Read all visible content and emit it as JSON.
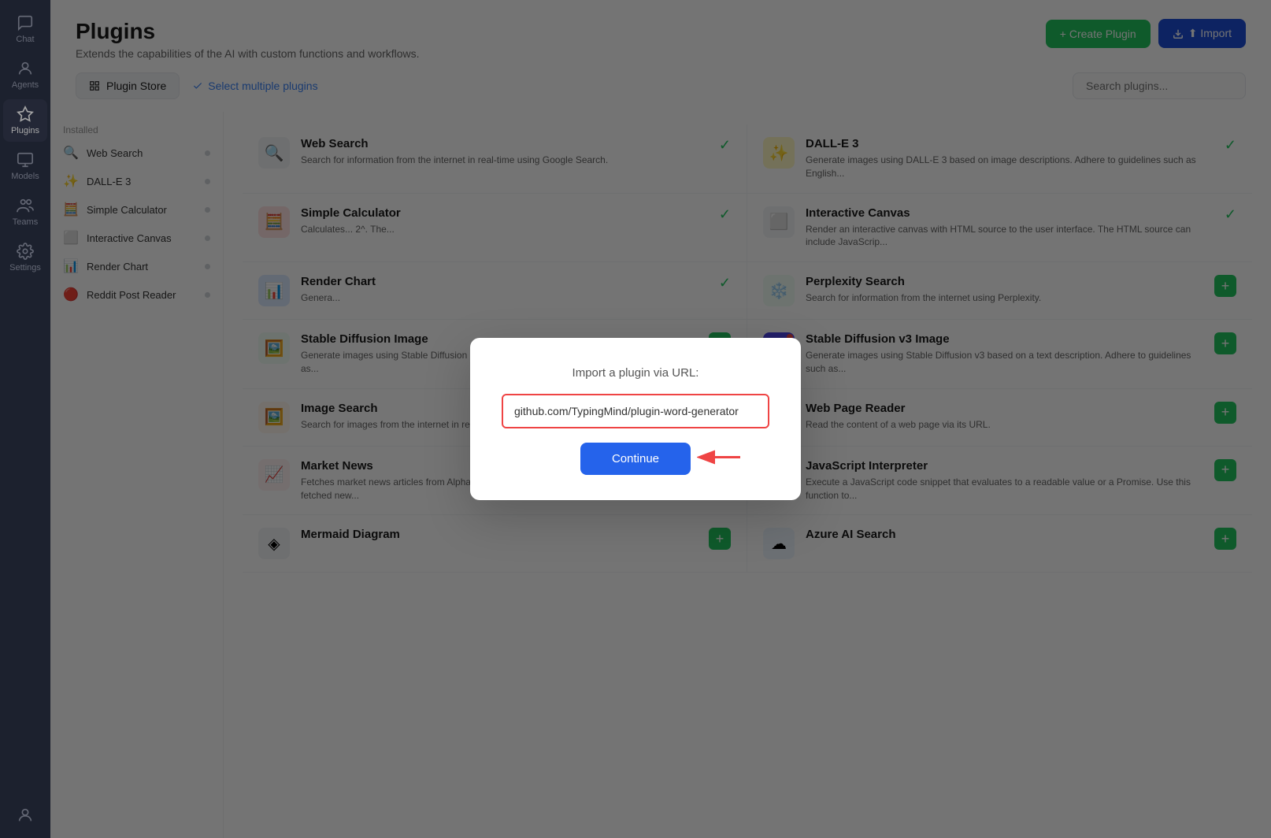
{
  "sidebar": {
    "items": [
      {
        "label": "Chat",
        "icon": "chat"
      },
      {
        "label": "Agents",
        "icon": "agents"
      },
      {
        "label": "Plugins",
        "icon": "plugins",
        "active": true
      },
      {
        "label": "Models",
        "icon": "models"
      },
      {
        "label": "Teams",
        "icon": "teams"
      },
      {
        "label": "Settings",
        "icon": "settings"
      }
    ],
    "bottom_user": "user-avatar"
  },
  "header": {
    "title": "Plugins",
    "subtitle": "Extends the capabilities of the AI with custom functions and workflows.",
    "create_label": "+ Create Plugin",
    "import_label": "⬆ Import"
  },
  "toolbar": {
    "plugin_store_label": "Plugin Store",
    "select_multiple_label": "Select multiple plugins",
    "search_placeholder": "Search plugins..."
  },
  "installed_label": "Installed",
  "sidebar_list": [
    {
      "name": "Web Search",
      "icon": "🔍"
    },
    {
      "name": "DALL-E 3",
      "icon": "✨"
    },
    {
      "name": "Simple Calculator",
      "icon": "🧮"
    },
    {
      "name": "Interactive Canvas",
      "icon": "⬜"
    },
    {
      "name": "Render Chart",
      "icon": "📊"
    },
    {
      "name": "Reddit Post Reader",
      "icon": "🔴"
    }
  ],
  "plugins": [
    {
      "name": "Web Search",
      "desc": "Search for information from the internet in real-time using Google Search.",
      "icon": "🔍",
      "icon_bg": "#f3f4f6",
      "status": "installed"
    },
    {
      "name": "DALL-E 3",
      "desc": "Generate images using DALL-E 3 based on image descriptions. Adhere to guidelines such as English...",
      "icon": "✨",
      "icon_bg": "#fef9c3",
      "status": "installed"
    },
    {
      "name": "Simple Calculator",
      "desc": "Calculates... 2^. The...",
      "icon": "🧮",
      "icon_bg": "#fee2e2",
      "status": "installed"
    },
    {
      "name": "Interactive Canvas",
      "desc": "Render an interactive canvas with HTML source to the user interface. The HTML source can include JavaScrip...",
      "icon": "⬜",
      "icon_bg": "#f3f4f6",
      "status": "installed"
    },
    {
      "name": "Render Chart",
      "desc": "Genera...",
      "icon": "📊",
      "icon_bg": "#dbeafe",
      "status": "installed"
    },
    {
      "name": "Perplexity Search",
      "desc": "Search for information from the internet using Perplexity.",
      "icon": "❄️",
      "icon_bg": "#f0fdf4",
      "status": "add"
    },
    {
      "name": "Stable Diffusion Image",
      "desc": "Generate images using Stable Diffusion based on a text description. Adhere to guidelines such as...",
      "icon": "🖼️",
      "icon_bg": "#f0fdf4",
      "status": "add"
    },
    {
      "name": "Stable Diffusion v3 Image",
      "desc": "Generate images using Stable Diffusion v3 based on a text description. Adhere to guidelines such as...",
      "icon": "S",
      "icon_bg": "#4f46e5",
      "icon_color": "white",
      "status": "add",
      "dot_red": true
    },
    {
      "name": "Image Search",
      "desc": "Search for images from the internet in real-time using Google Search.",
      "icon": "🖼️",
      "icon_bg": "#fff7ed",
      "status": "add"
    },
    {
      "name": "Web Page Reader",
      "desc": "Read the content of a web page via its URL.",
      "icon": "📄",
      "icon_bg": "#f8fafc",
      "status": "add"
    },
    {
      "name": "Market News",
      "desc": "Fetches market news articles from Alpha Vantage. This plugin automatically displays the fetched new...",
      "icon": "📈",
      "icon_bg": "#fff1f2",
      "status": "add"
    },
    {
      "name": "JavaScript Interpreter",
      "desc": "Execute a JavaScript code snippet that evaluates to a readable value or a Promise. Use this function to...",
      "icon": "—",
      "icon_bg": "#f3f4f6",
      "status": "add"
    },
    {
      "name": "Mermaid Diagram",
      "desc": "",
      "icon": "◈",
      "icon_bg": "#f3f4f6",
      "status": "add"
    },
    {
      "name": "Azure AI Search",
      "desc": "",
      "icon": "☁",
      "icon_bg": "#eff6ff",
      "status": "add"
    }
  ],
  "modal": {
    "title": "Import a plugin via URL:",
    "input_value": "github.com/TypingMind/plugin-word-generator",
    "continue_label": "Continue"
  },
  "colors": {
    "sidebar_bg": "#2c3347",
    "active_item": "#363d54",
    "green": "#22c55e",
    "blue": "#2563eb",
    "red_border": "#ef4444"
  }
}
